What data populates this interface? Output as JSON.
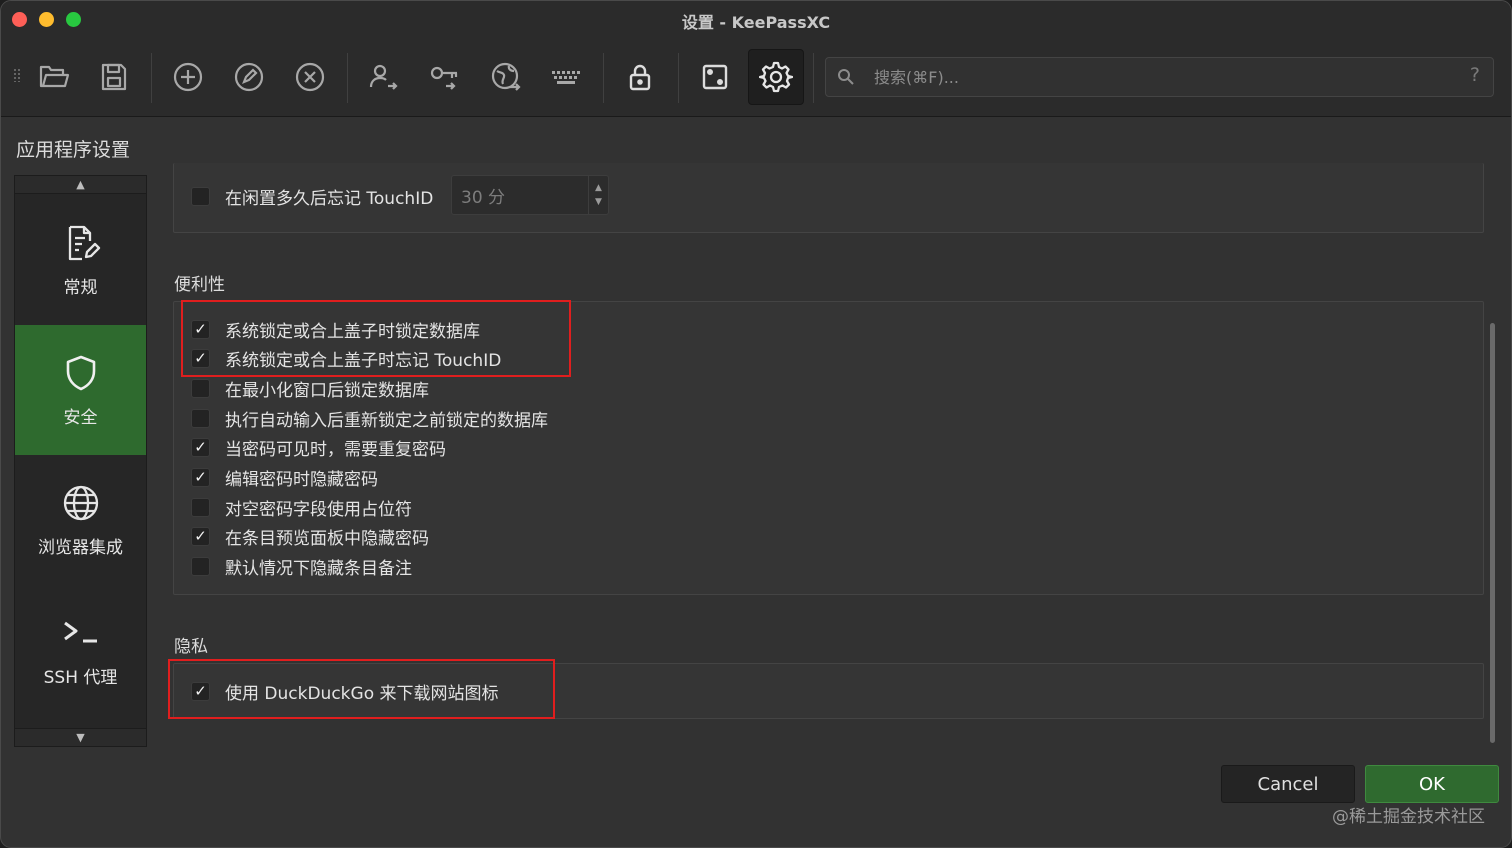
{
  "window": {
    "title": "设置 - KeePassXC"
  },
  "toolbar": {
    "icons": [
      "folder-open-icon",
      "save-icon",
      "plus-circle-icon",
      "edit-circle-icon",
      "x-circle-icon",
      "user-arrow-icon",
      "key-icon",
      "globe-arrow-icon",
      "keyboard-icon",
      "lock-icon",
      "dice-icon",
      "gear-icon"
    ],
    "active": "gear-icon",
    "search_placeholder": "搜索(⌘F)...",
    "help_label": "?"
  },
  "page_title": "应用程序设置",
  "sidebar": {
    "items": [
      {
        "label": "常规",
        "icon": "document-edit-icon",
        "active": false
      },
      {
        "label": "安全",
        "icon": "shield-icon",
        "active": true
      },
      {
        "label": "浏览器集成",
        "icon": "globe-icon",
        "active": false
      },
      {
        "label": "SSH 代理",
        "icon": "terminal-icon",
        "active": false
      }
    ]
  },
  "touchid_timeout": {
    "label": "在闲置多久后忘记 TouchID",
    "checked": false,
    "value": "30 分"
  },
  "sections": [
    {
      "title": "便利性",
      "options": [
        {
          "label": "系统锁定或合上盖子时锁定数据库",
          "checked": true
        },
        {
          "label": "系统锁定或合上盖子时忘记 TouchID",
          "checked": true
        },
        {
          "label": "在最小化窗口后锁定数据库",
          "checked": false
        },
        {
          "label": "执行自动输入后重新锁定之前锁定的数据库",
          "checked": false
        },
        {
          "label": "当密码可见时，需要重复密码",
          "checked": true
        },
        {
          "label": "编辑密码时隐藏密码",
          "checked": true
        },
        {
          "label": "对空密码字段使用占位符",
          "checked": false
        },
        {
          "label": "在条目预览面板中隐藏密码",
          "checked": true
        },
        {
          "label": "默认情况下隐藏条目备注",
          "checked": false
        }
      ]
    },
    {
      "title": "隐私",
      "options": [
        {
          "label": "使用 DuckDuckGo 来下载网站图标",
          "checked": true
        }
      ]
    }
  ],
  "buttons": {
    "cancel": "Cancel",
    "ok": "OK"
  },
  "watermark": "@稀土掘金技术社区",
  "colors": {
    "accent": "#2f6a2f",
    "highlight": "#e01e1e",
    "background": "#323232"
  }
}
